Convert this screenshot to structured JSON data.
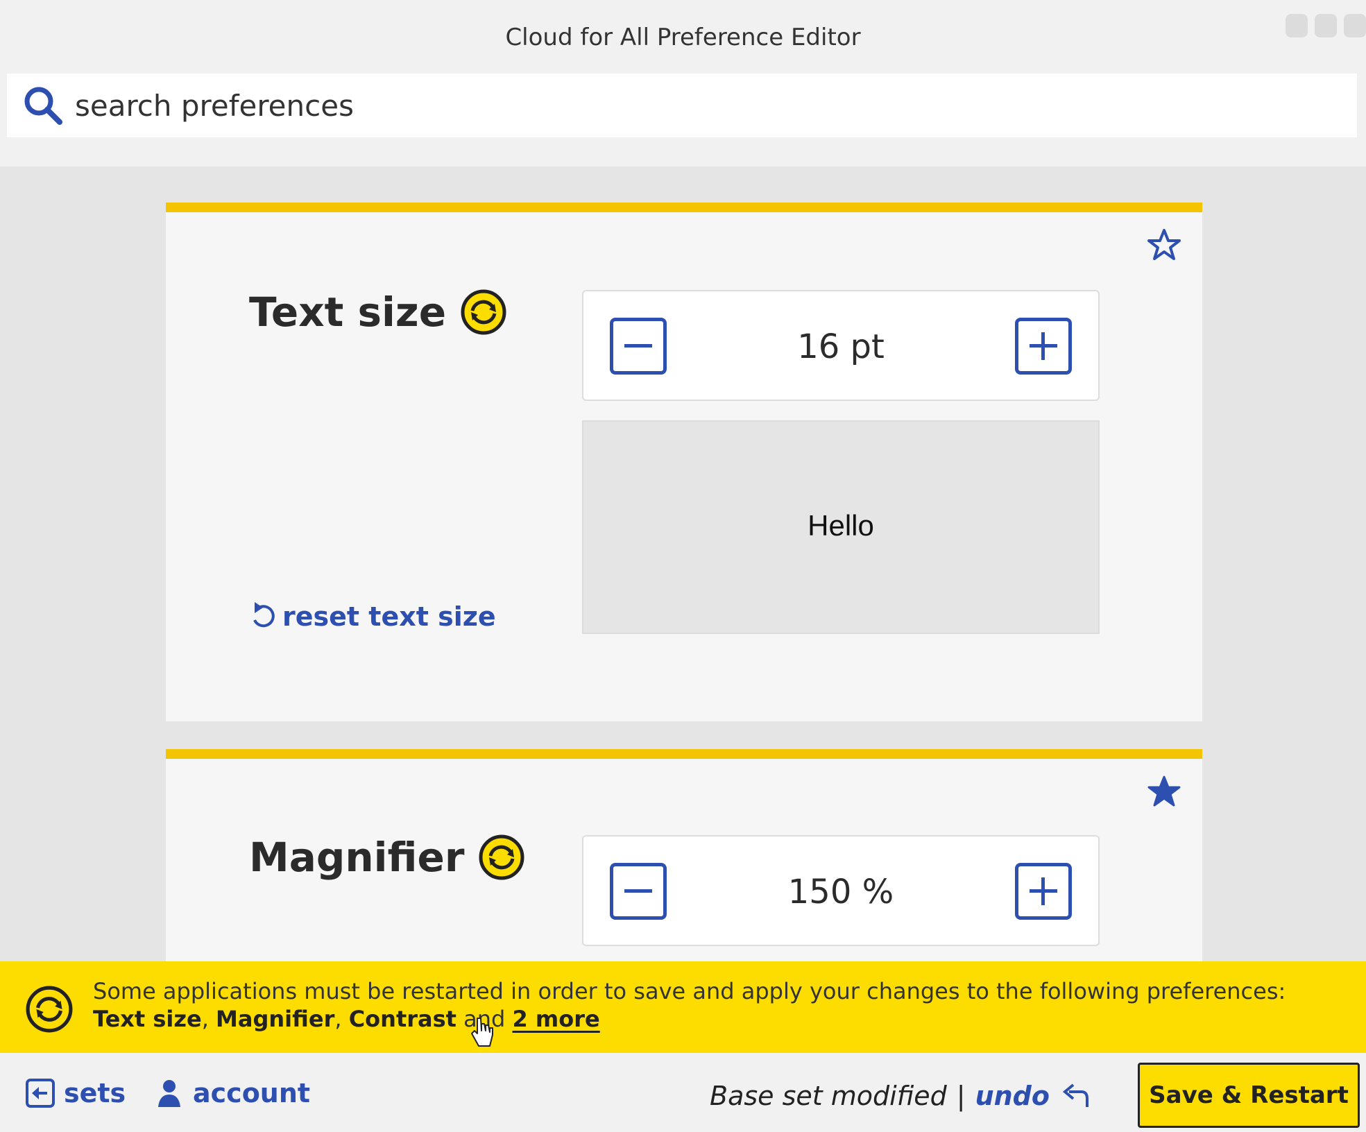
{
  "window": {
    "title": "Cloud for All Preference Editor"
  },
  "search": {
    "placeholder": "search preferences"
  },
  "cards": [
    {
      "title": "Text size",
      "value": "16 pt",
      "preview_text": "Hello",
      "reset_label": "reset text size",
      "starred": false
    },
    {
      "title": "Magnifier",
      "value": "150 %",
      "starred": true
    }
  ],
  "banner": {
    "message": "Some applications must be restarted in order to save and apply your changes to the following preferences:",
    "pref1": "Text size",
    "pref2": "Magnifier",
    "pref3": "Contrast",
    "sep": ",",
    "and": "and",
    "more": "2 more"
  },
  "footer": {
    "sets_label": "sets",
    "account_label": "account",
    "status_text": "Base set modified",
    "divider": "|",
    "undo_label": "undo",
    "save_label": "Save & Restart"
  },
  "colors": {
    "accent_blue": "#2d4fb0",
    "brand_yellow": "#fddc00",
    "card_border": "#f5c400"
  }
}
